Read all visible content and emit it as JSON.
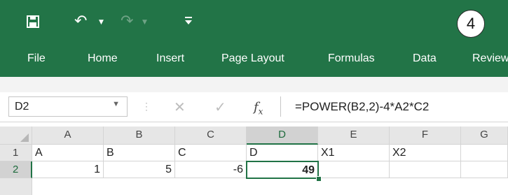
{
  "qat": {
    "save_icon": "save-icon",
    "undo_icon": "undo-icon",
    "redo_icon": "redo-icon",
    "customize_icon": "customize-qat-icon"
  },
  "step_badge": "4",
  "ribbon": {
    "tabs": [
      "File",
      "Home",
      "Insert",
      "Page Layout",
      "Formulas",
      "Data",
      "Review"
    ]
  },
  "formula_bar": {
    "name_box": "D2",
    "cancel_icon": "✕",
    "enter_icon": "✓",
    "fx_label": "fx",
    "formula": "=POWER(B2,2)-4*A2*C2"
  },
  "sheet": {
    "columns": [
      "A",
      "B",
      "C",
      "D",
      "E",
      "F",
      "G"
    ],
    "rows": [
      {
        "num": "1",
        "cells": [
          "A",
          "B",
          "C",
          "D",
          "X1",
          "X2",
          ""
        ]
      },
      {
        "num": "2",
        "cells": [
          "1",
          "5",
          "-6",
          "49",
          "",
          "",
          ""
        ]
      }
    ],
    "active_cell": "D2"
  },
  "colors": {
    "excel_green": "#227447",
    "active_border": "#217346"
  }
}
